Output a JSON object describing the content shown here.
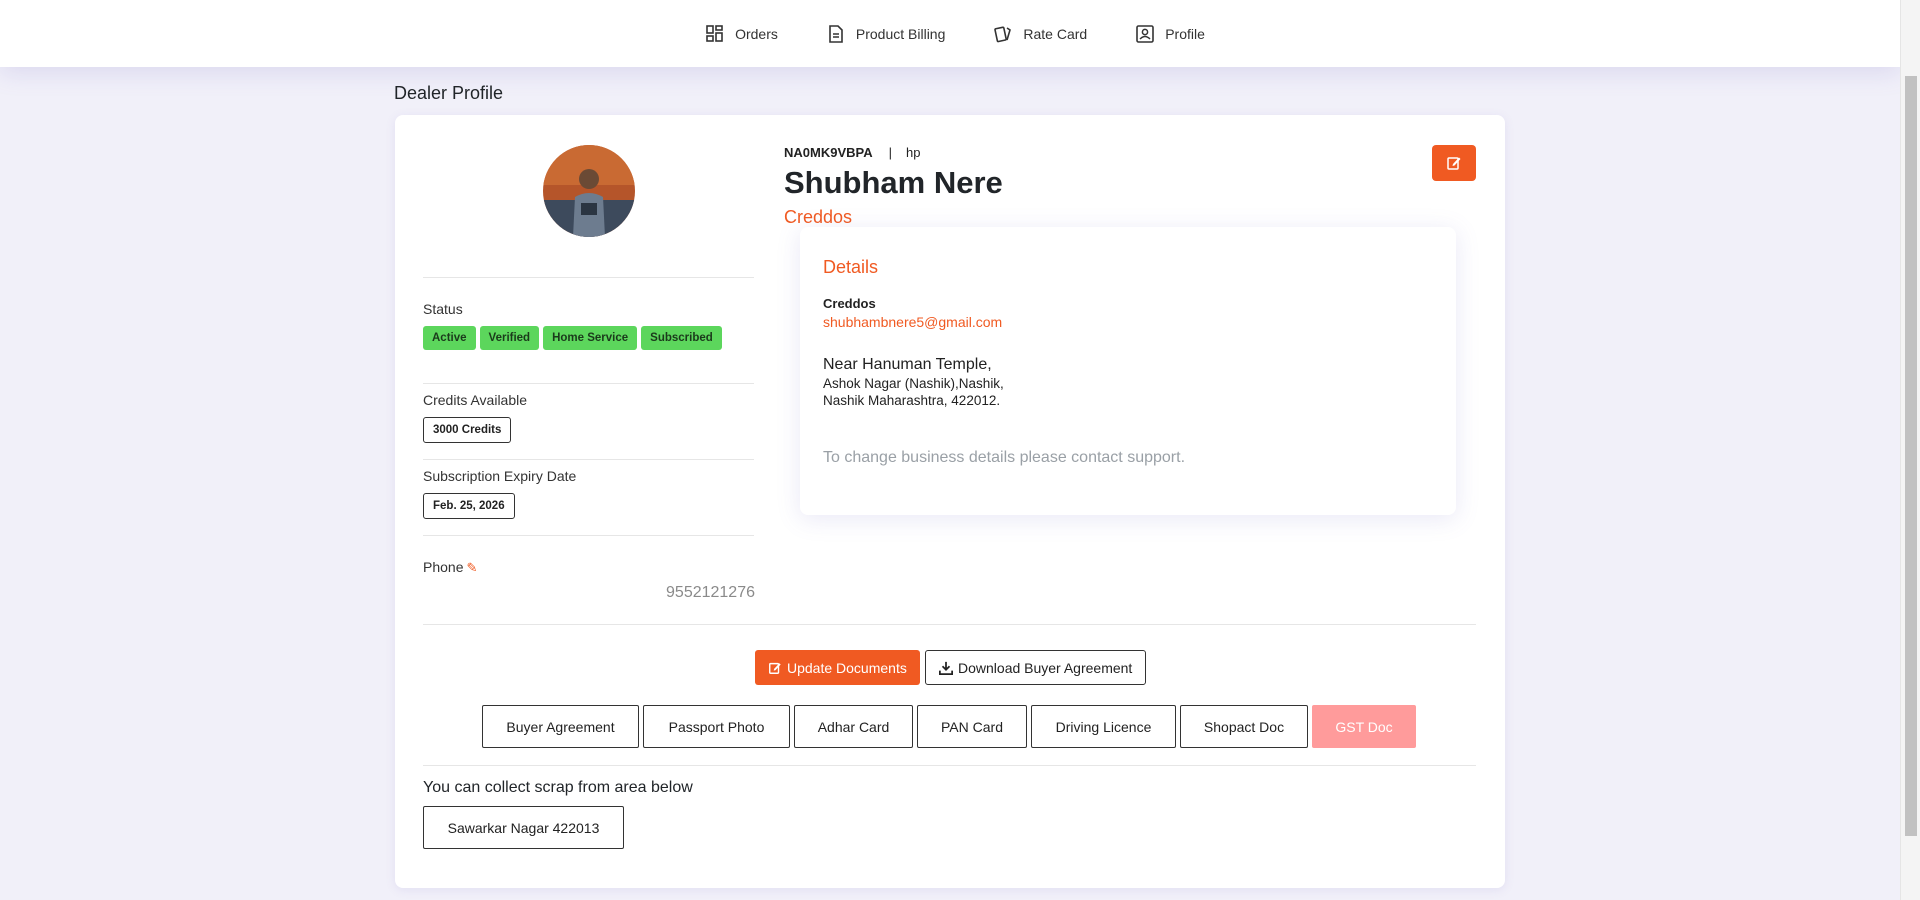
{
  "nav": {
    "items": [
      {
        "label": "Orders",
        "icon": "grid-icon"
      },
      {
        "label": "Product Billing",
        "icon": "document-icon"
      },
      {
        "label": "Rate Card",
        "icon": "cards-icon"
      },
      {
        "label": "Profile",
        "icon": "profile-icon"
      }
    ]
  },
  "page": {
    "title": "Dealer Profile"
  },
  "profile": {
    "code": "NA0MK9VBPA",
    "separator": "|",
    "brand": "hp",
    "name": "Shubham Nere",
    "company": "Creddos",
    "status_label": "Status",
    "badges": [
      "Active",
      "Verified",
      "Home Service",
      "Subscribed"
    ],
    "credits_label": "Credits Available",
    "credits_value": "3000 Credits",
    "expiry_label": "Subscription Expiry Date",
    "expiry_value": "Feb. 25, 2026",
    "phone_label": "Phone",
    "phone_value": "9552121276"
  },
  "details": {
    "title": "Details",
    "company": "Creddos",
    "email": "shubhambnere5@gmail.com",
    "address_line1": "Near Hanuman Temple,",
    "address_line2": "Ashok Nagar (Nashik),Nashik,",
    "address_line3": "Nashik Maharashtra, 422012.",
    "support_note": "To change business details please contact support."
  },
  "actions": {
    "update_documents": "Update Documents",
    "download_agreement": "Download Buyer Agreement"
  },
  "documents": [
    {
      "label": "Buyer Agreement",
      "disabled": false
    },
    {
      "label": "Passport Photo",
      "disabled": false
    },
    {
      "label": "Adhar Card",
      "disabled": false
    },
    {
      "label": "PAN Card",
      "disabled": false
    },
    {
      "label": "Driving Licence",
      "disabled": false
    },
    {
      "label": "Shopact Doc",
      "disabled": false
    },
    {
      "label": "GST Doc",
      "disabled": true
    }
  ],
  "collection": {
    "title": "You can collect scrap from area below",
    "areas": [
      "Sawarkar Nagar 422013"
    ]
  },
  "colors": {
    "accent": "#f05a22",
    "badge_green": "#5cd65c",
    "disabled_doc": "#ff9b9b"
  }
}
